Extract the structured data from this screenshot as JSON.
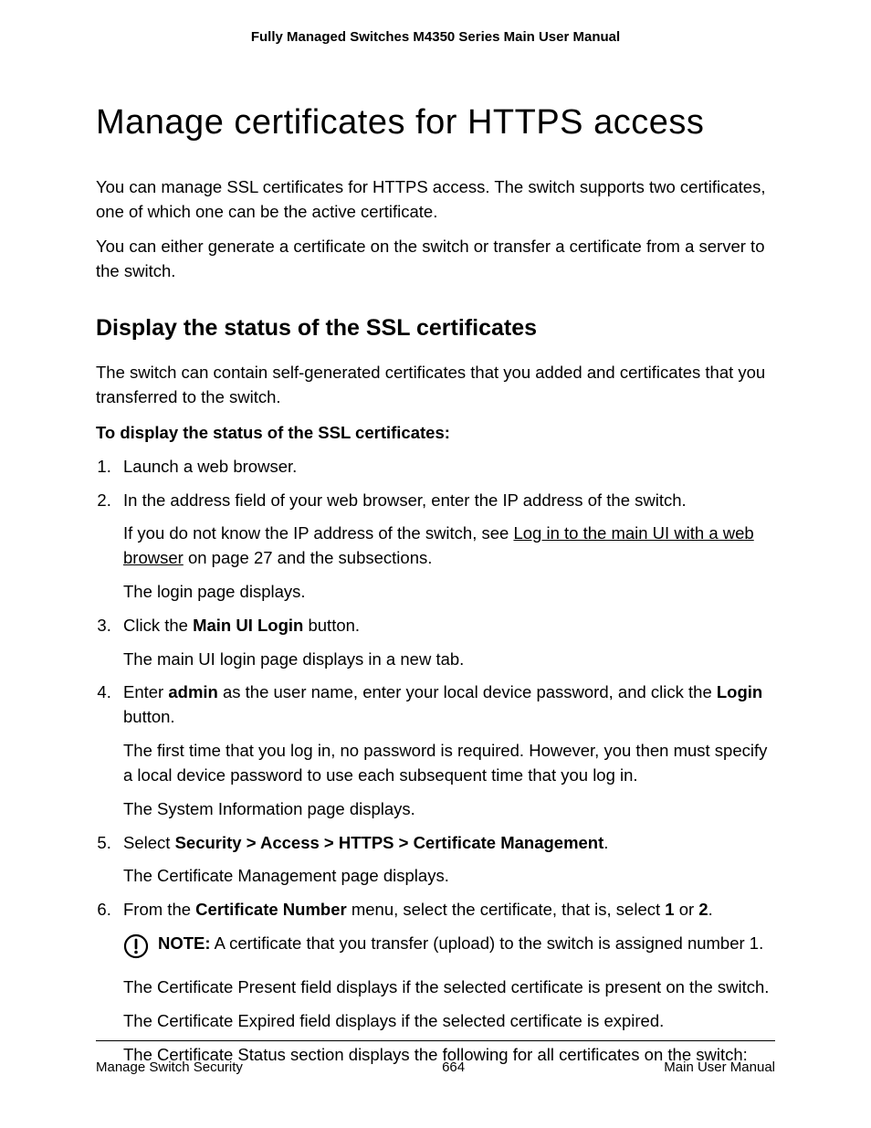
{
  "header": {
    "title": "Fully Managed Switches M4350 Series Main User Manual"
  },
  "main": {
    "h1": "Manage certificates for HTTPS access",
    "intro_p1": "You can manage SSL certificates for HTTPS access. The switch supports two certificates, one of which one can be the active certificate.",
    "intro_p2": "You can either generate a certificate on the switch or transfer a certificate from a server to the switch.",
    "h2": "Display the status of the SSL certificates",
    "section_intro": "The switch can contain self-generated certificates that you added and certificates that you transferred to the switch.",
    "instr_heading": "To display the status of the SSL certificates:",
    "steps": {
      "s1": "Launch a web browser.",
      "s2": "In the address field of your web browser, enter the IP address of the switch.",
      "s2_sub1_pre": "If you do not know the IP address of the switch, see ",
      "s2_sub1_link": "Log in to the main UI with a web browser",
      "s2_sub1_post": " on page 27 and the subsections.",
      "s2_sub2": "The login page displays.",
      "s3_pre": "Click the ",
      "s3_bold": "Main UI Login",
      "s3_post": " button.",
      "s3_sub1": "The main UI login page displays in a new tab.",
      "s4_pre": "Enter ",
      "s4_b1": "admin",
      "s4_mid": " as the user name, enter your local device password, and click the ",
      "s4_b2": "Login",
      "s4_post": " button.",
      "s4_sub1": "The first time that you log in, no password is required. However, you then must specify a local device password to use each subsequent time that you log in.",
      "s4_sub2": "The System Information page displays.",
      "s5_pre": "Select ",
      "s5_bold": "Security > Access > HTTPS > Certificate Management",
      "s5_post": ".",
      "s5_sub1": "The Certificate Management page displays.",
      "s6_pre": "From the ",
      "s6_b1": "Certificate Number",
      "s6_mid": " menu, select the certificate, that is, select ",
      "s6_b2": "1",
      "s6_mid2": " or ",
      "s6_b3": "2",
      "s6_post": ".",
      "note_label": "NOTE:",
      "note_text": "  A certificate that you transfer (upload) to the switch is assigned number 1.",
      "s6_sub1": "The Certificate Present field displays if the selected certificate is present on the switch.",
      "s6_sub2": "The Certificate Expired field displays if the selected certificate is expired.",
      "s6_sub3": "The Certificate Status section displays the following for all certificates on the switch:"
    }
  },
  "footer": {
    "left": "Manage Switch Security",
    "center": "664",
    "right": "Main User Manual"
  }
}
